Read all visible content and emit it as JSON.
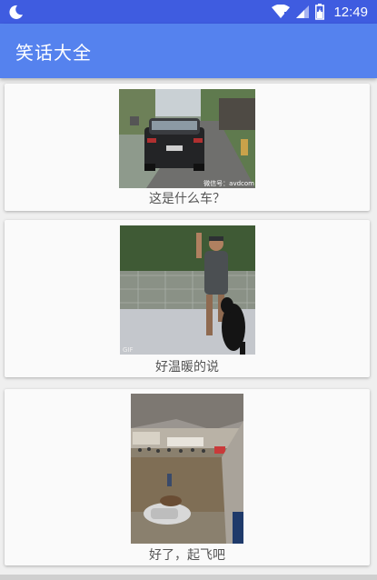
{
  "status_bar": {
    "time": "12:49",
    "icons": [
      "moon-icon",
      "wifi-icon",
      "signal-icon",
      "battery-icon"
    ]
  },
  "app": {
    "title": "笑话大全"
  },
  "feed": {
    "items": [
      {
        "caption": "这是什么车？",
        "watermark": "微信号：avdcom"
      },
      {
        "caption": "好温暖的说"
      },
      {
        "caption": "好了，起飞吧"
      }
    ]
  },
  "colors": {
    "status_bar": "#3f5ce0",
    "app_bar": "#5582ee",
    "background": "#efefef",
    "card": "#fafafa"
  }
}
